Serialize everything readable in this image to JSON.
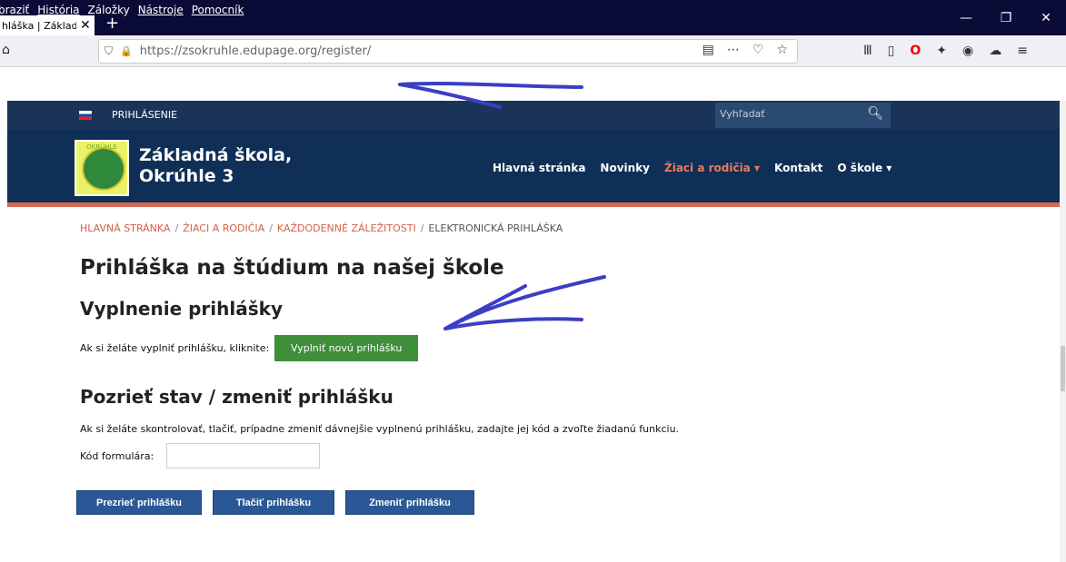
{
  "browser": {
    "menu": [
      "braziť",
      "História",
      "Záložky",
      "Nástroje",
      "Pomocník"
    ],
    "tab_title": "hláška | Základná",
    "tab_close": "✕",
    "newtab": "+",
    "url": "https://zsokruhle.edupage.org/register/",
    "win": {
      "min": "—",
      "max": "❐",
      "close": "✕"
    }
  },
  "site": {
    "top_label": "PRIHLÁSENIE",
    "search_placeholder": "Vyhľadať",
    "school_name_1": "Základná škola,",
    "school_name_2": "Okrúhle 3",
    "logo_text": "OKRÚHLE",
    "nav": [
      "Hlavná stránka",
      "Novinky",
      "Žiaci a rodičia ▾",
      "Kontakt",
      "O škole ▾"
    ]
  },
  "breadcrumb": [
    "HLAVNÁ STRÁNKA",
    "ŽIACI A RODIČIA",
    "KAŽDODENNÉ ZÁLEŽITOSTI",
    "ELEKTRONICKÁ PRIHLÁŠKA"
  ],
  "page": {
    "title": "Prihláška na štúdium na našej škole",
    "section1_title": "Vyplnenie prihlášky",
    "section1_text": "Ak si želáte vyplniť prihlášku, kliknite:",
    "new_button": "Vyplniť novú prihlášku",
    "section2_title": "Pozrieť stav / zmeniť prihlášku",
    "section2_text": "Ak si želáte skontrolovať, tlačiť, prípadne zmeniť dávnejšie vyplnenú prihlášku, zadajte jej kód a zvoľte žiadanú funkciu.",
    "code_label": "Kód formulára:",
    "code_value": "",
    "btn_view": "Prezrieť prihlášku",
    "btn_print": "Tlačiť prihlášku",
    "btn_change": "Zmeniť prihlášku"
  },
  "colors": {
    "header": "#102f56",
    "accent": "#d46a54",
    "green_button": "#3e8e3a",
    "blue_button": "#2a5896",
    "annotation": "#3b3fc4"
  }
}
